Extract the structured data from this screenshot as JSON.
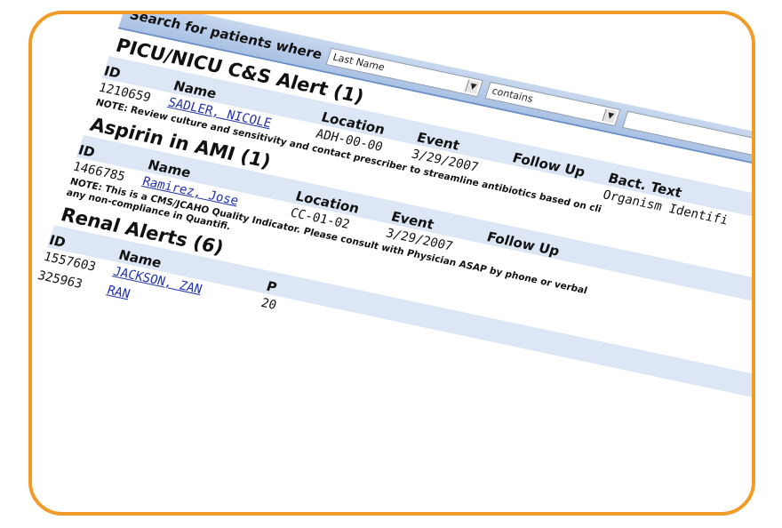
{
  "search": {
    "label": "Search for patients where",
    "field_value": "Last Name",
    "operator_value": "contains"
  },
  "sections": [
    {
      "title": "PICU/NICU C&S Alert (1)",
      "headers": [
        "ID",
        "Name",
        "Location",
        "Event",
        "Follow Up",
        "Bact. Text"
      ],
      "rows": [
        {
          "id": "1210659",
          "name": "SADLER, NICOLE",
          "location": "ADH-00-00",
          "event": "3/29/2007",
          "bact": "Organism Identifi"
        }
      ],
      "note": "NOTE: Review culture and sensitivity and contact prescriber to streamline antibiotics based on cli"
    },
    {
      "title": "Aspirin in AMI (1)",
      "headers": [
        "ID",
        "Name",
        "Location",
        "Event",
        "Follow Up"
      ],
      "rows": [
        {
          "id": "1466785",
          "name": "Ramirez, Jose",
          "location": "CC-01-02",
          "event": "3/29/2007"
        }
      ],
      "note": "NOTE: This is a CMS/JCAHO Quality Indicator. Please consult with Physician ASAP by phone or verbal",
      "note2": "any non-compliance in Quantifi."
    },
    {
      "title": "Renal Alerts (6)",
      "headers": [
        "ID",
        "Name",
        "P"
      ],
      "rows": [
        {
          "id": "1557603",
          "name": "JACKSON, ZAN",
          "extra": "20"
        },
        {
          "id": "325963",
          "name": "RAN"
        }
      ]
    }
  ],
  "colors": {
    "frame": "#f29b28",
    "header_band": "#dde6f4",
    "link": "#2233aa"
  }
}
